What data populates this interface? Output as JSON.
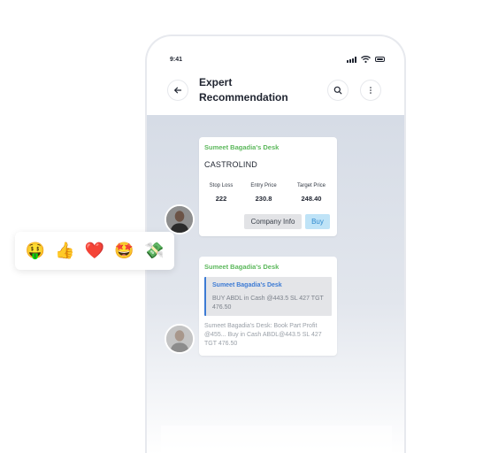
{
  "status_bar": {
    "time": "9:41"
  },
  "header": {
    "title": "Expert Recommendation"
  },
  "recommendation": {
    "desk": "Sumeet Bagadia's Desk",
    "symbol": "CASTROLIND",
    "metrics": [
      {
        "label": "Stop Loss",
        "value": "222"
      },
      {
        "label": "Entry Price",
        "value": "230.8"
      },
      {
        "label": "Target Price",
        "value": "248.40"
      }
    ],
    "company_info_label": "Company Info",
    "buy_label": "Buy"
  },
  "reply_message": {
    "desk": "Sumeet Bagadia's Desk",
    "quote_title": "Sumeet Bagadia's Desk",
    "quote_text": "BUY ABDL in Cash @443.5 SL 427 TGT 476.50",
    "text": "Sumeet Bagadia's Desk: Book Part Profit @455... Buy in Cash ABDL@443.5 SL 427 TGT 476.50"
  },
  "reactions": [
    {
      "name": "money-mouth-face",
      "glyph": "🤑"
    },
    {
      "name": "thumbs-up",
      "glyph": "👍"
    },
    {
      "name": "red-heart",
      "glyph": "❤️"
    },
    {
      "name": "star-struck",
      "glyph": "🤩"
    },
    {
      "name": "money-with-wings",
      "glyph": "💸"
    }
  ],
  "colors": {
    "desk_green": "#5cb85c",
    "quote_accent": "#3d7bd4",
    "buy_bg": "#bfe3f7",
    "chat_bg": "#d6dce6"
  }
}
